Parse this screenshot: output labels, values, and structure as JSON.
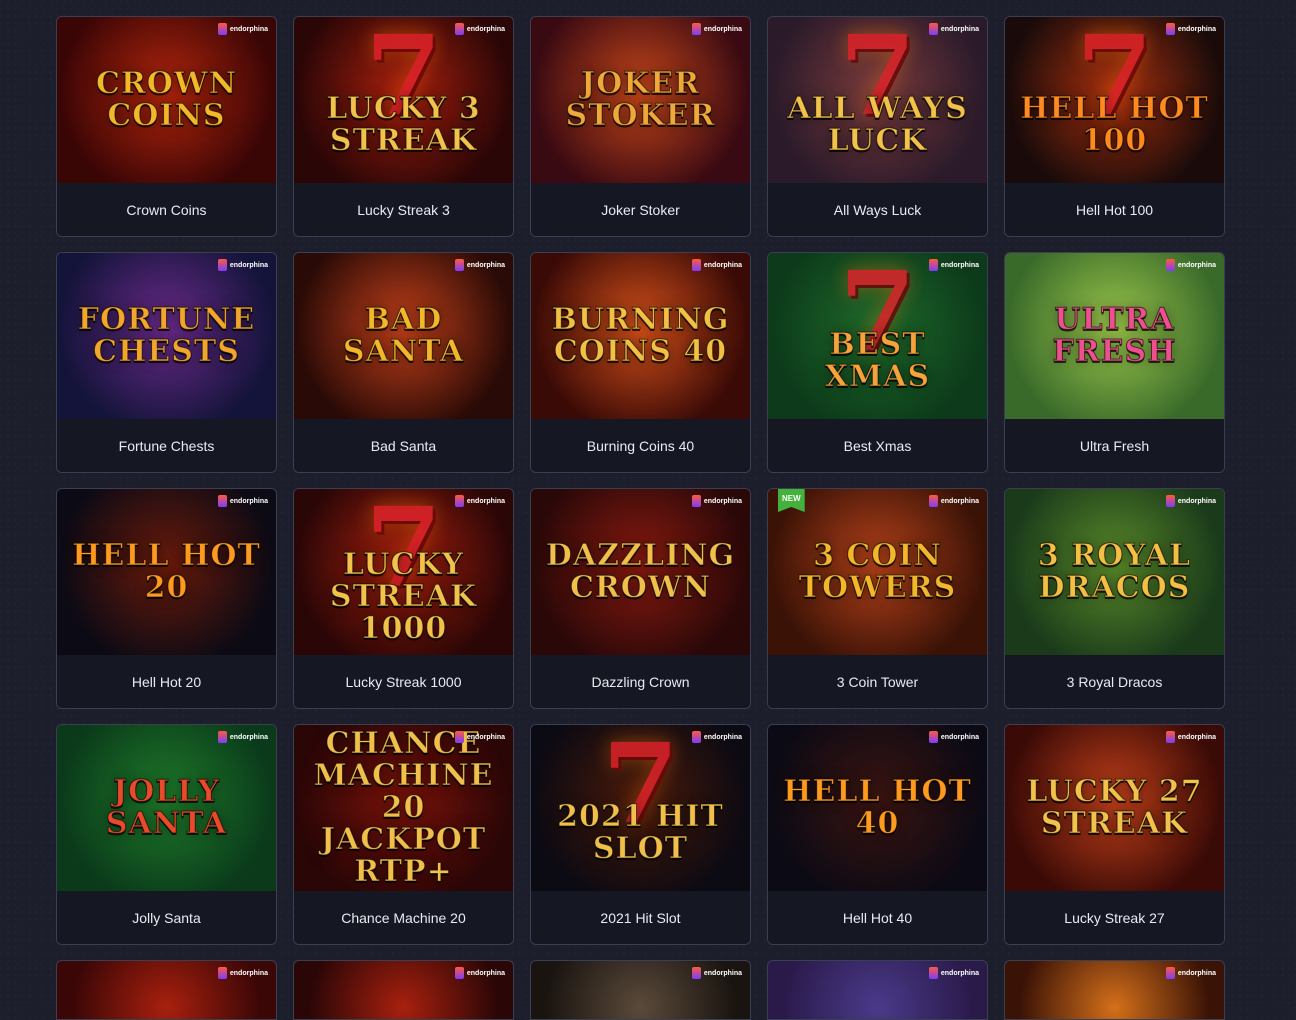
{
  "brand_label": "endorphina",
  "new_label": "NEW",
  "games": [
    {
      "title": "Crown Coins",
      "logo": "CROWN COINS",
      "bg": [
        "#3a0505",
        "#b3260d"
      ],
      "logo_color": "#f4b72a",
      "seven": false,
      "new": false
    },
    {
      "title": "Lucky Streak 3",
      "logo": "Lucky 3 STREAK",
      "bg": [
        "#2b0606",
        "#a8200e"
      ],
      "logo_color": "#f3c24a",
      "seven": true,
      "new": false
    },
    {
      "title": "Joker Stoker",
      "logo": "JOKER STOKER",
      "bg": [
        "#3a0a12",
        "#c7461a"
      ],
      "logo_color": "#f0a838",
      "seven": false,
      "new": false
    },
    {
      "title": "All Ways Luck",
      "logo": "All Ways LUCK",
      "bg": [
        "#2a1a2a",
        "#7a3b3b"
      ],
      "logo_color": "#f3c24a",
      "seven": true,
      "new": false
    },
    {
      "title": "Hell Hot 100",
      "logo": "HELL HOT 100",
      "bg": [
        "#1a0b0a",
        "#a8300e"
      ],
      "logo_color": "#ff8a1e",
      "seven": true,
      "new": false
    },
    {
      "title": "Fortune Chests",
      "logo": "FORTUNE CHESTS",
      "bg": [
        "#14143a",
        "#6a2a8a"
      ],
      "logo_color": "#f2a62c",
      "seven": false,
      "new": false
    },
    {
      "title": "Bad Santa",
      "logo": "BAD SANTA",
      "bg": [
        "#2a0a06",
        "#c2401a"
      ],
      "logo_color": "#f4b72a",
      "seven": false,
      "new": false
    },
    {
      "title": "Burning Coins 40",
      "logo": "BURNING COINS 40",
      "bg": [
        "#3a0a06",
        "#d4501a"
      ],
      "logo_color": "#f4c044",
      "seven": false,
      "new": false
    },
    {
      "title": "Best Xmas",
      "logo": "Best Xmas",
      "bg": [
        "#0c3a1a",
        "#1f6a2a"
      ],
      "logo_color": "#f4a43a",
      "seven": true,
      "new": false
    },
    {
      "title": "Ultra Fresh",
      "logo": "Ultra Fresh",
      "bg": [
        "#3a6a2a",
        "#9ac64a"
      ],
      "logo_color": "#ef4f8e",
      "seven": false,
      "new": false
    },
    {
      "title": "Hell Hot 20",
      "logo": "HELL HOT 20",
      "bg": [
        "#0c0a14",
        "#6a1a0a"
      ],
      "logo_color": "#ff9a1e",
      "seven": false,
      "new": false
    },
    {
      "title": "Lucky Streak 1000",
      "logo": "Lucky STREAK 1000",
      "bg": [
        "#2a0606",
        "#a8200e"
      ],
      "logo_color": "#f3c24a",
      "seven": true,
      "new": false
    },
    {
      "title": "Dazzling Crown",
      "logo": "Dazzling Crown",
      "bg": [
        "#2a0808",
        "#8a1a10"
      ],
      "logo_color": "#f2c04a",
      "seven": false,
      "new": false
    },
    {
      "title": "3 Coin Tower",
      "logo": "3 COIN TOWERS",
      "bg": [
        "#3a1206",
        "#b5421a"
      ],
      "logo_color": "#f4b72a",
      "seven": false,
      "new": true
    },
    {
      "title": "3 Royal Dracos",
      "logo": "3 ROYAL DRACOS",
      "bg": [
        "#1a3a1a",
        "#5a8a2a"
      ],
      "logo_color": "#f4c044",
      "seven": false,
      "new": false
    },
    {
      "title": "Jolly Santa",
      "logo": "JOLLY SANTA",
      "bg": [
        "#0a3a1a",
        "#1f7a2a"
      ],
      "logo_color": "#e84a2a",
      "seven": false,
      "new": false
    },
    {
      "title": "Chance Machine 20",
      "logo": "CHANCE machine 20 JACKPOT RTP+",
      "bg": [
        "#2a0606",
        "#7a120a"
      ],
      "logo_color": "#f2c04a",
      "seven": false,
      "new": false
    },
    {
      "title": "2021 Hit Slot",
      "logo": "2021 HIT SLOT",
      "bg": [
        "#0c0a12",
        "#4a1a0a"
      ],
      "logo_color": "#f2c04a",
      "seven": true,
      "new": false
    },
    {
      "title": "Hell Hot 40",
      "logo": "HELL HOT 40",
      "bg": [
        "#0c0a14",
        "#3a1410"
      ],
      "logo_color": "#ff9a1e",
      "seven": false,
      "new": false
    },
    {
      "title": "Lucky Streak 27",
      "logo": "Lucky 27 STREAK",
      "bg": [
        "#3a0a06",
        "#c2401a"
      ],
      "logo_color": "#f3c24a",
      "seven": false,
      "new": false
    }
  ],
  "partial_row": [
    {
      "bg": [
        "#3a0606",
        "#a8200e"
      ]
    },
    {
      "bg": [
        "#2a0606",
        "#a8200e"
      ]
    },
    {
      "bg": [
        "#1a1410",
        "#5a4a3a"
      ]
    },
    {
      "bg": [
        "#2a1a4a",
        "#4a3a8a"
      ]
    },
    {
      "bg": [
        "#3a1206",
        "#d4701a"
      ]
    }
  ]
}
